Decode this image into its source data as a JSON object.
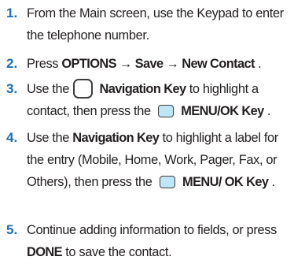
{
  "steps": [
    {
      "number": "1.",
      "parts": [
        {
          "text": "From the Main screen, use the Keypad to enter the telephone number."
        }
      ]
    },
    {
      "number": "2.",
      "parts": [
        {
          "text": "Press "
        },
        {
          "bold": "OPTIONS → Save → New Contact"
        },
        {
          "text": "."
        }
      ]
    },
    {
      "number": "3.",
      "parts": [
        {
          "text": "Use the "
        },
        {
          "icon": "navigation-key-icon"
        },
        {
          "bold": "Navigation Key"
        },
        {
          "text": " to highlight a contact, then press the "
        },
        {
          "icon": "menu-ok-key-icon"
        },
        {
          "bold": "MENU/OK Key"
        },
        {
          "text": "."
        }
      ]
    },
    {
      "number": "4.",
      "parts": [
        {
          "text": "Use the "
        },
        {
          "bold": "Navigation Key"
        },
        {
          "text": " to highlight a label for the entry (Mobile, Home, Work, Pager, Fax, or Others), then press the "
        },
        {
          "icon": "menu-ok-key-icon"
        },
        {
          "bold": "MENU/ OK Key"
        },
        {
          "text": "."
        }
      ]
    },
    {
      "number": "5.",
      "parts": [
        {
          "text": "Continue adding information to fields, or press "
        },
        {
          "bold": "DONE"
        },
        {
          "text": " to save the contact."
        }
      ]
    }
  ],
  "colors": {
    "step_number": "#1b6fb5",
    "body_text": "#231f20",
    "menu_key_fill": "#bfe6f6"
  }
}
